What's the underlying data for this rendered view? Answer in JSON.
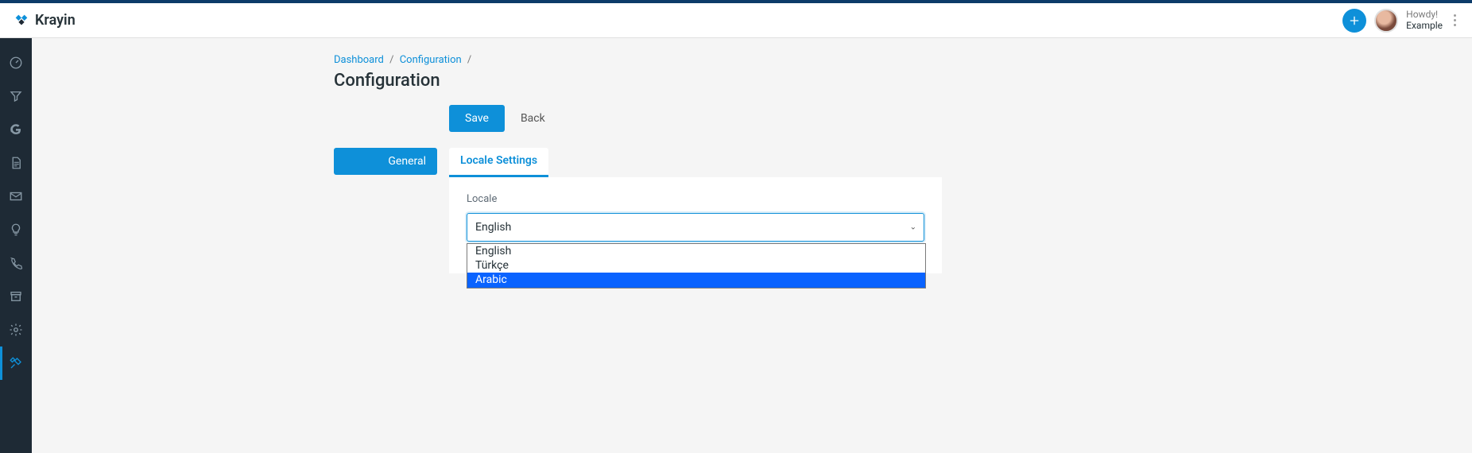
{
  "brand": "Krayin",
  "header": {
    "greeting": "Howdy!",
    "username": "Example"
  },
  "breadcrumb": {
    "items": [
      "Dashboard",
      "Configuration"
    ],
    "trailing_sep": "/"
  },
  "page_title": "Configuration",
  "actions": {
    "save": "Save",
    "back": "Back"
  },
  "left_tabs": {
    "general": "General"
  },
  "panel": {
    "tab_label": "Locale Settings",
    "field_label": "Locale",
    "selected": "English",
    "options": [
      "English",
      "Türkçe",
      "Arabic"
    ],
    "highlighted_index": 2
  },
  "sidebar_icons": [
    "dashboard-icon",
    "funnel-icon",
    "google-icon",
    "document-icon",
    "mail-icon",
    "bulb-icon",
    "phone-icon",
    "archive-icon",
    "gear-icon",
    "tools-icon"
  ]
}
